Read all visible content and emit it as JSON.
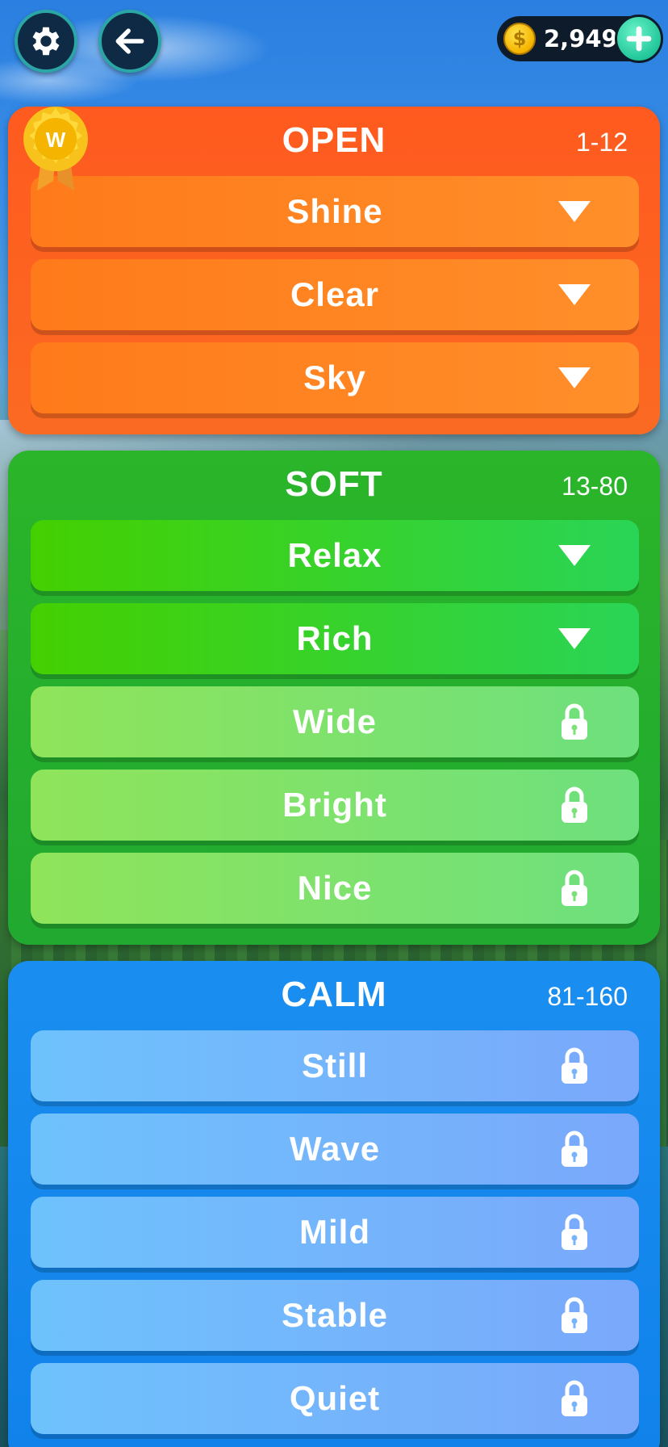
{
  "top_bar": {
    "settings_icon": "gear-icon",
    "back_icon": "arrow-left-icon",
    "coins": "2,949",
    "coin_symbol": "$",
    "add_coins_icon": "plus-icon"
  },
  "badge": {
    "letter": "W",
    "icon": "ribbon-medal-icon"
  },
  "packs": [
    {
      "title": "OPEN",
      "range": "1-12",
      "color": "#ff5a1f",
      "levels": [
        {
          "label": "Shine",
          "state": "unlocked",
          "icon": "triangle-down-icon"
        },
        {
          "label": "Clear",
          "state": "unlocked",
          "icon": "triangle-down-icon"
        },
        {
          "label": "Sky",
          "state": "unlocked",
          "icon": "triangle-down-icon"
        }
      ]
    },
    {
      "title": "SOFT",
      "range": "13-80",
      "color": "#21a930",
      "levels": [
        {
          "label": "Relax",
          "state": "unlocked",
          "icon": "triangle-down-icon"
        },
        {
          "label": "Rich",
          "state": "unlocked",
          "icon": "triangle-down-icon"
        },
        {
          "label": "Wide",
          "state": "locked",
          "icon": "lock-icon"
        },
        {
          "label": "Bright",
          "state": "locked",
          "icon": "lock-icon"
        },
        {
          "label": "Nice",
          "state": "locked",
          "icon": "lock-icon"
        }
      ]
    },
    {
      "title": "CALM",
      "range": "81-160",
      "color": "#1082ea",
      "levels": [
        {
          "label": "Still",
          "state": "locked",
          "icon": "lock-icon"
        },
        {
          "label": "Wave",
          "state": "locked",
          "icon": "lock-icon"
        },
        {
          "label": "Mild",
          "state": "locked",
          "icon": "lock-icon"
        },
        {
          "label": "Stable",
          "state": "locked",
          "icon": "lock-icon"
        },
        {
          "label": "Quiet",
          "state": "locked",
          "icon": "lock-icon"
        }
      ]
    }
  ]
}
